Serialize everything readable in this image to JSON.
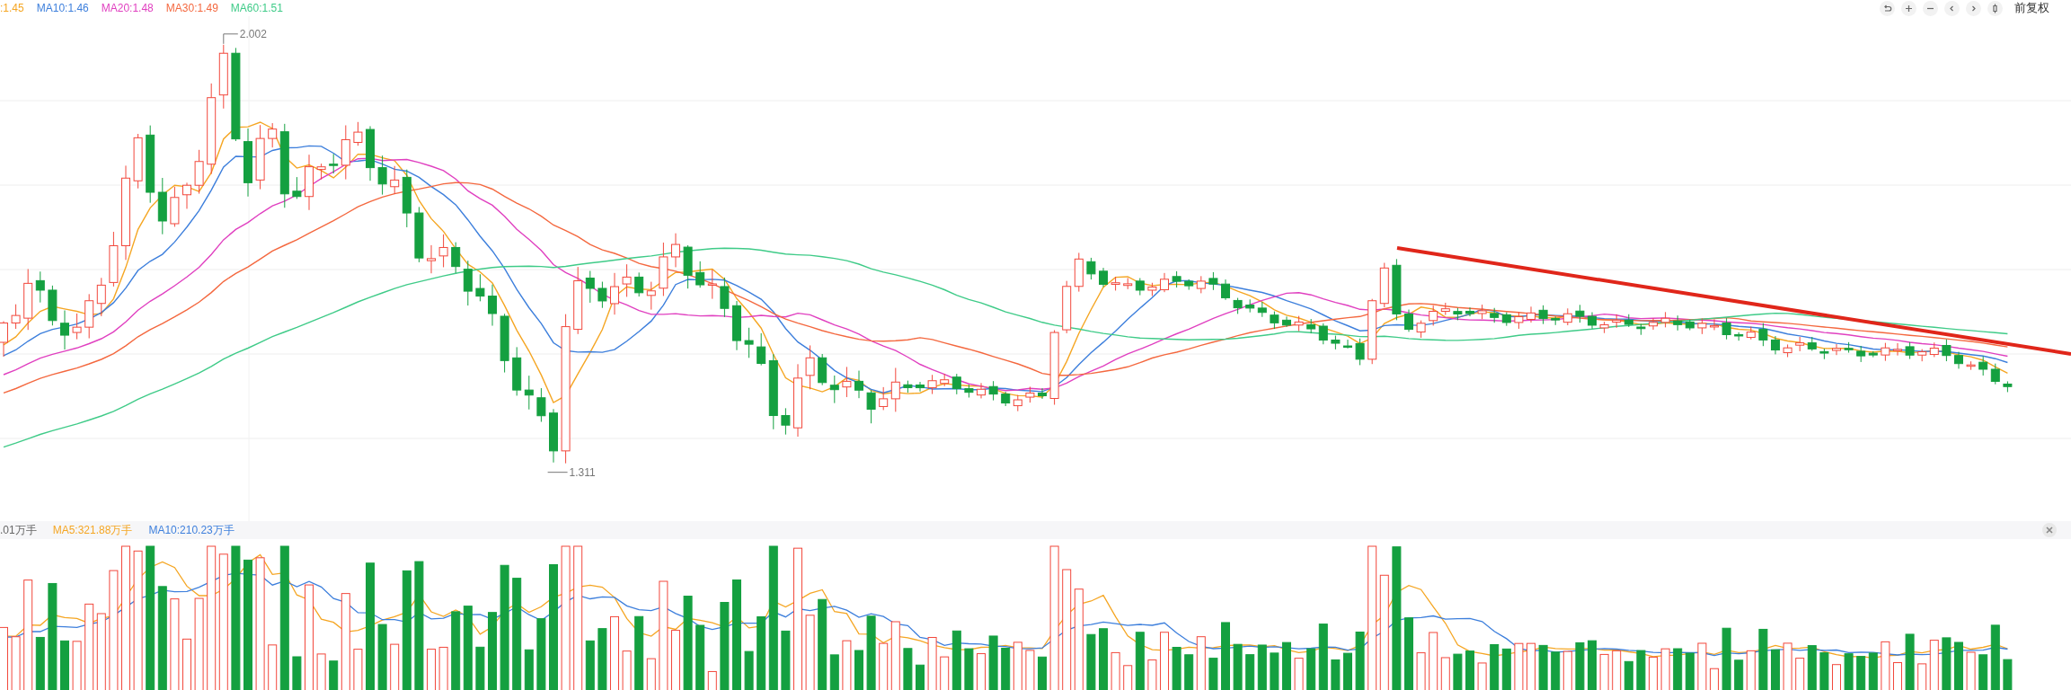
{
  "legend": [
    {
      "text": ":1.45",
      "color": "#f5a623"
    },
    {
      "text": "MA10:1.46",
      "color": "#3d7fdc"
    },
    {
      "text": "MA20:1.48",
      "color": "#e040c0"
    },
    {
      "text": "MA30:1.49",
      "color": "#f4683f"
    },
    {
      "text": "MA60:1.51",
      "color": "#3fcb88"
    }
  ],
  "toolbar": {
    "buttons": [
      {
        "kind": "back"
      },
      {
        "kind": "plus"
      },
      {
        "kind": "minus"
      },
      {
        "kind": "left"
      },
      {
        "kind": "right"
      },
      {
        "kind": "candle"
      }
    ],
    "price_adjust": "前复权"
  },
  "chart": {
    "high_label": "2.002",
    "low_label": "1.311"
  },
  "volume": {
    "legend": [
      {
        "text": ".01万手",
        "color": "#666666"
      },
      {
        "text": "MA5:321.88万手",
        "color": "#f5a623"
      },
      {
        "text": "MA10:210.23万手",
        "color": "#3d7fdc"
      }
    ]
  }
}
